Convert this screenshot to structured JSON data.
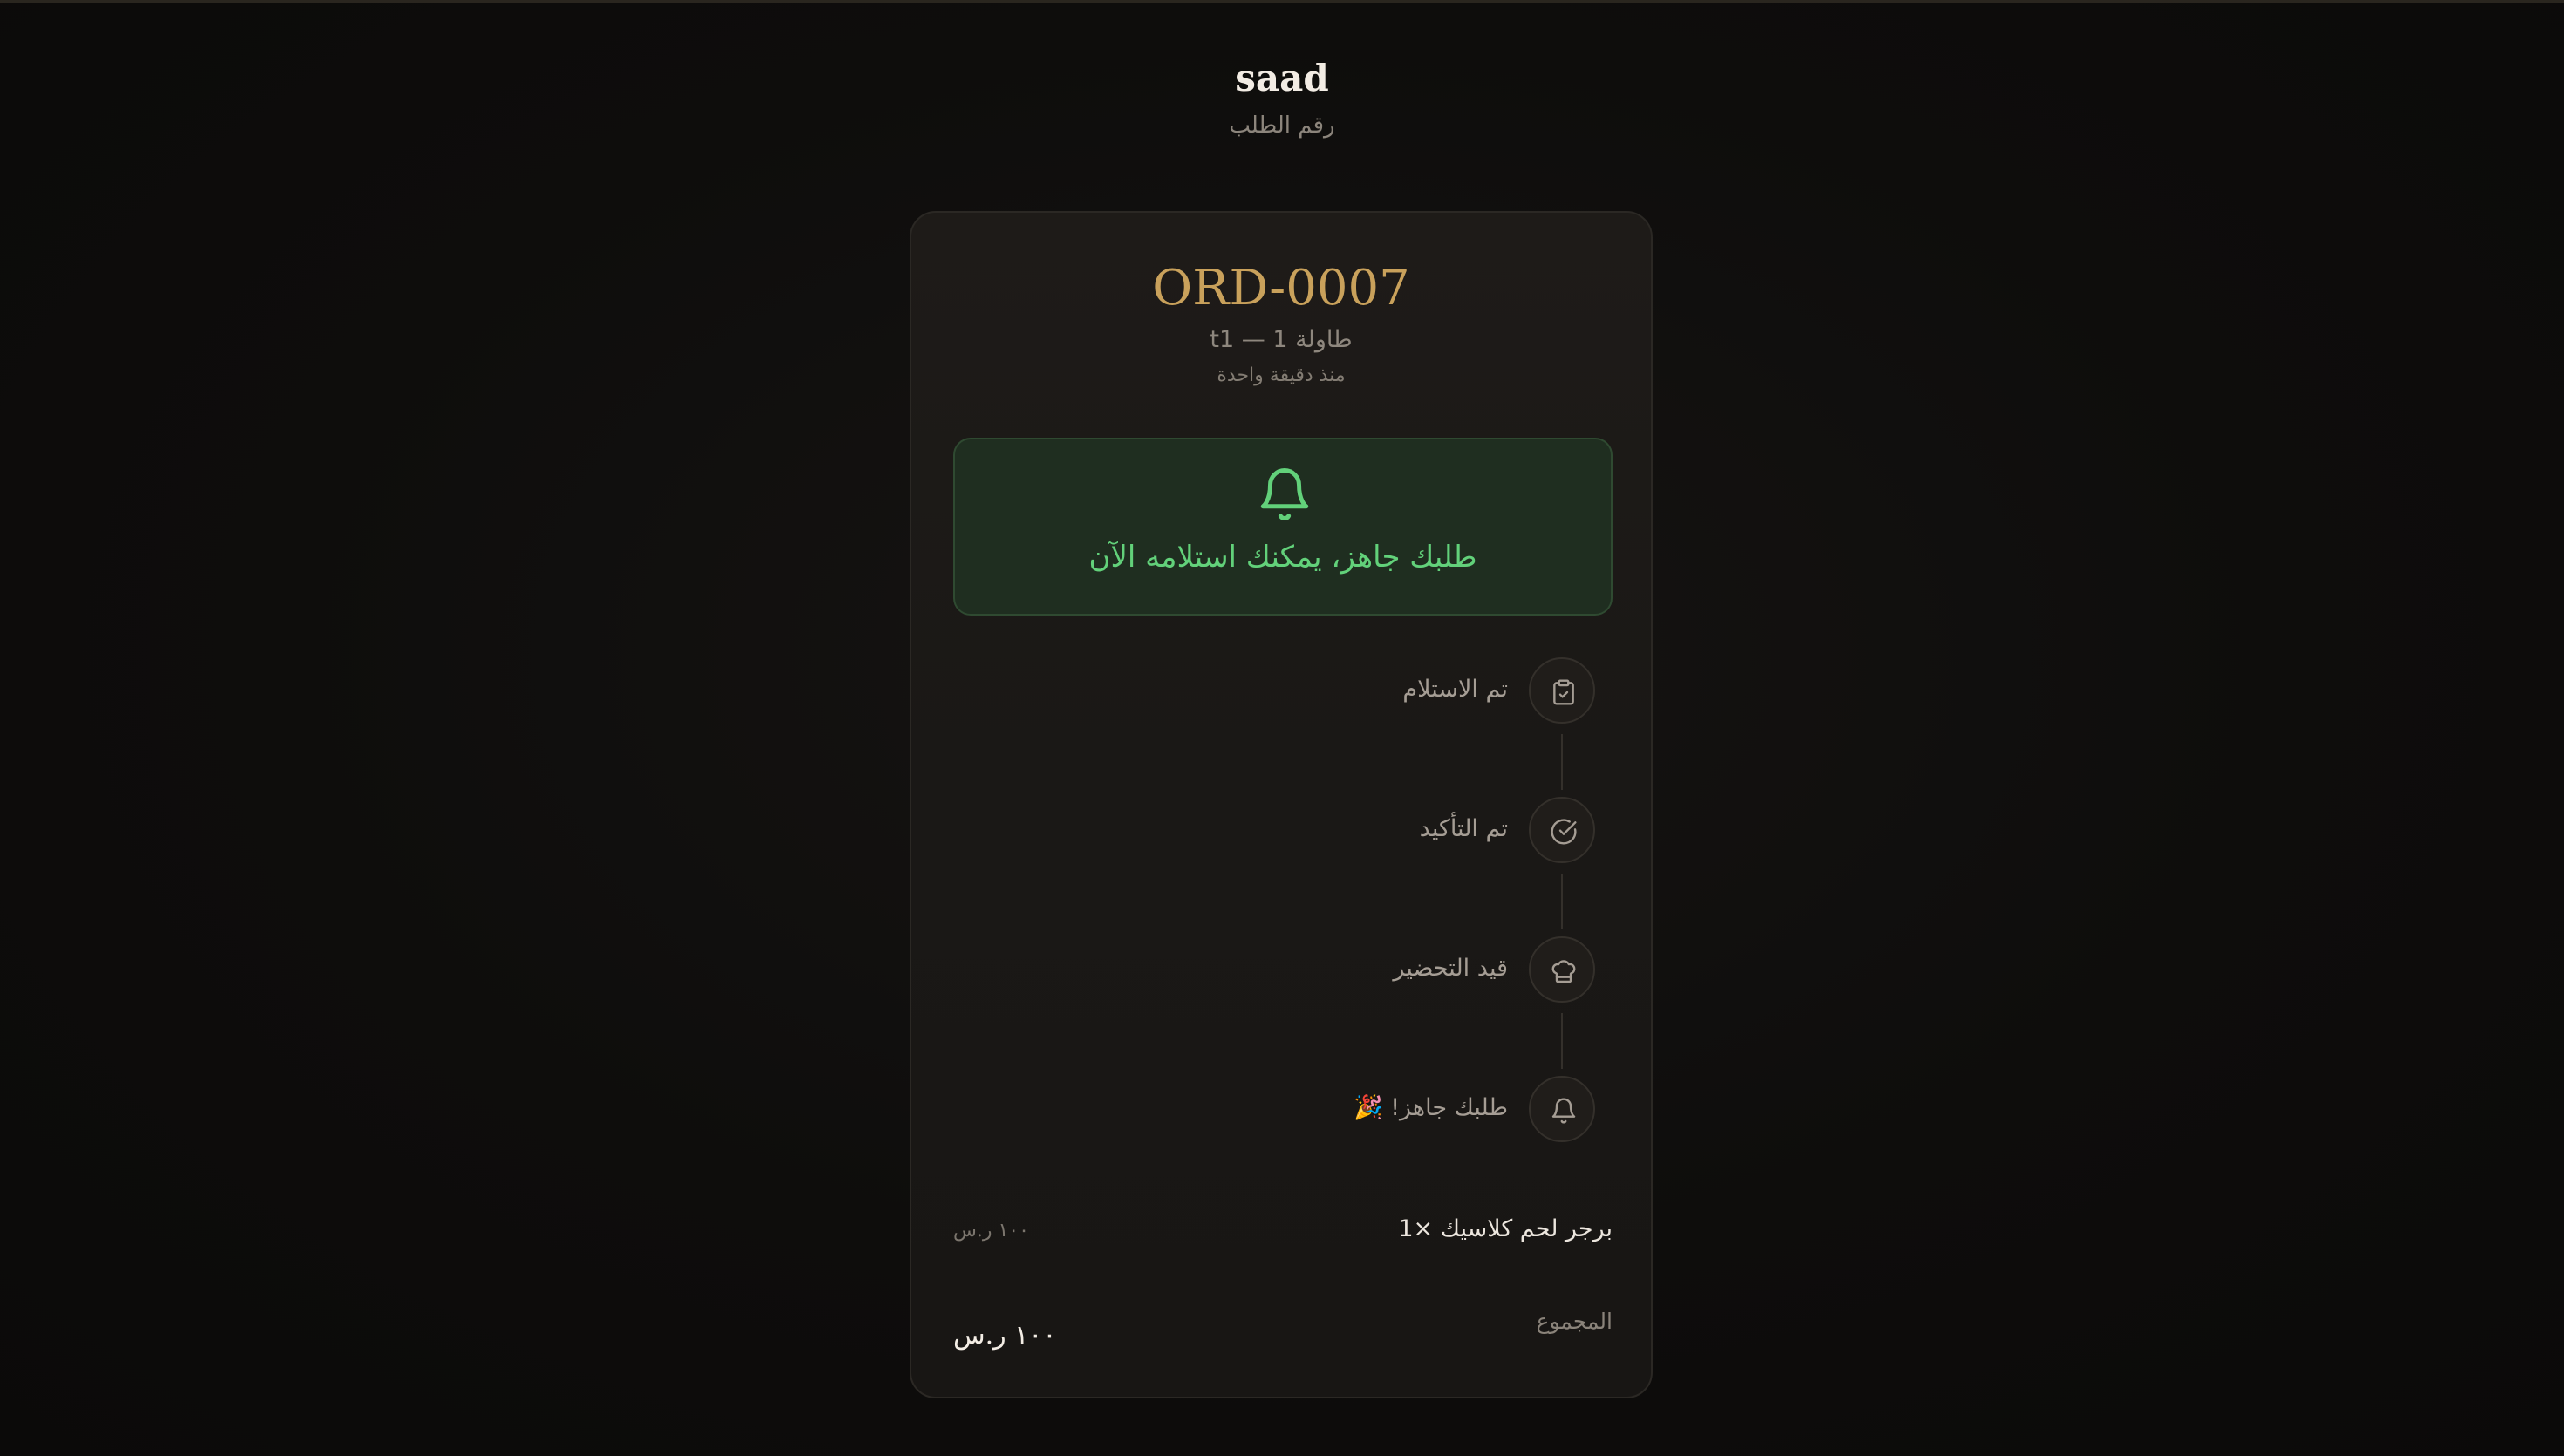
{
  "header": {
    "store_name": "saad",
    "order_label": "رقم الطلب"
  },
  "order": {
    "number": "ORD-0007",
    "table": "طاولة 1 — t1",
    "time_ago": "منذ دقيقة واحدة"
  },
  "ready_banner": {
    "icon": "bell-icon",
    "text": "طلبك جاهز، يمكنك استلامه الآن",
    "color": "#62d17a"
  },
  "steps": [
    {
      "label": "تم الاستلام",
      "icon": "clipboard-check-icon"
    },
    {
      "label": "تم التأكيد",
      "icon": "check-circle-icon"
    },
    {
      "label": "قيد التحضير",
      "icon": "chef-hat-icon"
    },
    {
      "label": "طلبك جاهز! 🎉",
      "icon": "bell-icon"
    }
  ],
  "items": [
    {
      "name": "1× برجر لحم كلاسيك",
      "price": "١٠٠ ر.س"
    }
  ],
  "total": {
    "label": "المجموع",
    "value": "١٠٠ ر.س"
  },
  "colors": {
    "accent_gold": "#c9a15b",
    "success_green": "#62d17a",
    "background": "#0e0d0c"
  }
}
